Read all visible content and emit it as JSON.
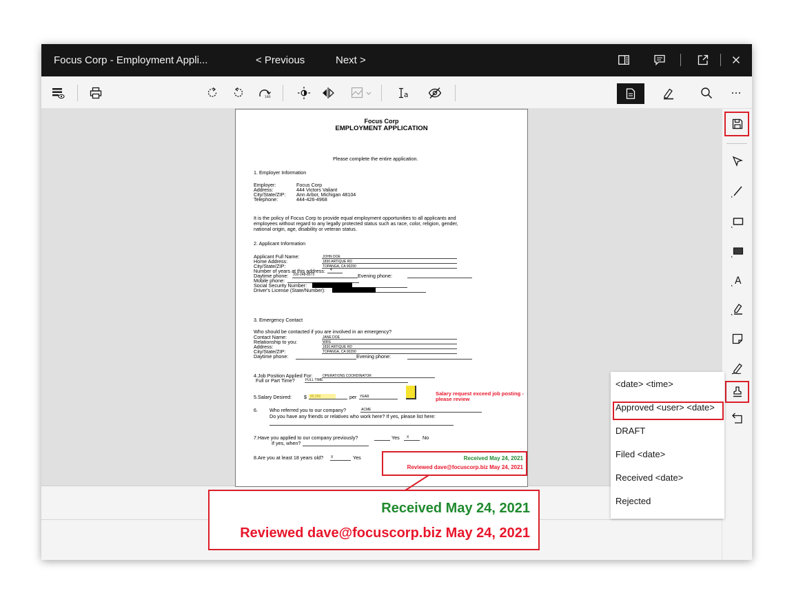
{
  "window": {
    "title": "Focus Corp - Employment Appli...",
    "prev_label": "< Previous",
    "next_label": "Next >"
  },
  "titlebar_icons": [
    "sidebar-toggle-icon",
    "comments-icon",
    "launch-icon",
    "close-icon"
  ],
  "toolbar_icons": [
    "redaction-menu-icon",
    "print-icon",
    "rotate-right-icon",
    "rotate-left-icon",
    "rotate-180-icon",
    "brightness-icon",
    "flip-horizontal-icon",
    "image-adjust-icon",
    "text-select-icon",
    "hide-annotations-icon",
    "document-view-icon",
    "annotate-icon",
    "search-icon",
    "overflow-menu-icon"
  ],
  "sidebar_icons": [
    "save-icon",
    "select-pointer-icon",
    "line-icon",
    "rectangle-outline-icon",
    "rectangle-filled-icon",
    "text-icon",
    "highlighter-icon",
    "sticky-note-icon",
    "freehand-pen-icon",
    "stamp-icon",
    "undo-icon"
  ],
  "document": {
    "company": "Focus Corp",
    "heading": "EMPLOYMENT APPLICATION",
    "intro": "Please complete the entire application.",
    "s1_title": "1.      Employer Information",
    "emp_labels": [
      "Employer:",
      "Address:",
      "City/State/ZIP:",
      "Telephone:"
    ],
    "emp_values": [
      "Focus Corp",
      "444 Victors Valiant",
      "Ann Arbor, Michigan 48104",
      "444-426-4968"
    ],
    "policy": [
      "It is the policy of Focus Corp to provide equal employment opportunities to all applicants and",
      "employees without regard to any legally protected status such as race, color, religion, gender,",
      "national origin, age, disability or veteran status."
    ],
    "s2_title": "2.      Applicant Information",
    "app_labels": [
      "Applicant Full Name:",
      "Home Address:",
      "City/State/ZIP:",
      "Number of years at this address:",
      "Daytime phone:",
      "Mobile phone:",
      "Social Security Number:",
      "Driver's License (State/Number):"
    ],
    "app_values": {
      "name": "JOHN DOE",
      "address": "1830 ARTIQUE RD",
      "city": "TOPANGA, CA 90290",
      "years": "4",
      "daytime": "310-248-8573"
    },
    "evening_label": "Evening phone:",
    "s3_title": "3.      Emergency Contact",
    "emergency_q": "Who should be contacted if you are involved in an emergency?",
    "em_labels": [
      "Contact Name:",
      "Relationship to you:",
      "Address:",
      "City/State/ZIP:",
      "Daytime phone:"
    ],
    "em_values": [
      "JANE DOE",
      "WIFE",
      "1830 ARTIQUE RD",
      "TOPANGA, CA 90290"
    ],
    "s4_label": "4.Job Position Applied For:",
    "s4_value": "OPERATIONS COORDINATOR",
    "fulltime_label": "Full or Part Time?",
    "fulltime_value": "FULL TIME",
    "s5_label": "5.Salary Desired:",
    "dollar": "$",
    "salary_value": "85,000",
    "per_label": "per",
    "per_value": "YEAR",
    "note": "Salary request exceed job posting - please review",
    "s6_num": "6.",
    "s6_q1": "Who referred you to our company?",
    "s6_v1": "ACME",
    "s6_q2": "Do you have any friends or relatives who work here? If yes, please list here:",
    "s7_q": "7.Have you applied to our company previously?",
    "s7_yes": "Yes",
    "s7_x": "X",
    "s7_no": "No",
    "s7_when": "If yes, when?",
    "s8_q": "8.Are you at least 18 years old?",
    "s8_x": "X",
    "s8_yes": "Yes"
  },
  "stamp": {
    "received": "Received May 24, 2021",
    "reviewed": "Reviewed dave@focuscorp.biz May 24, 2021"
  },
  "stamp_menu": {
    "items": [
      "<date> <time>",
      "Approved <user> <date>",
      "DRAFT",
      "Filed <date>",
      "Received <date>",
      "Rejected"
    ],
    "highlighted_index": 1
  },
  "colors": {
    "title_bar": "#161616",
    "annotation_red": "#da1e28",
    "stamp_green": "#1f8a2e",
    "stamp_red": "#e8162b",
    "salary_highlight": "#fff3a0",
    "sticky_note": "#f7e22e"
  }
}
